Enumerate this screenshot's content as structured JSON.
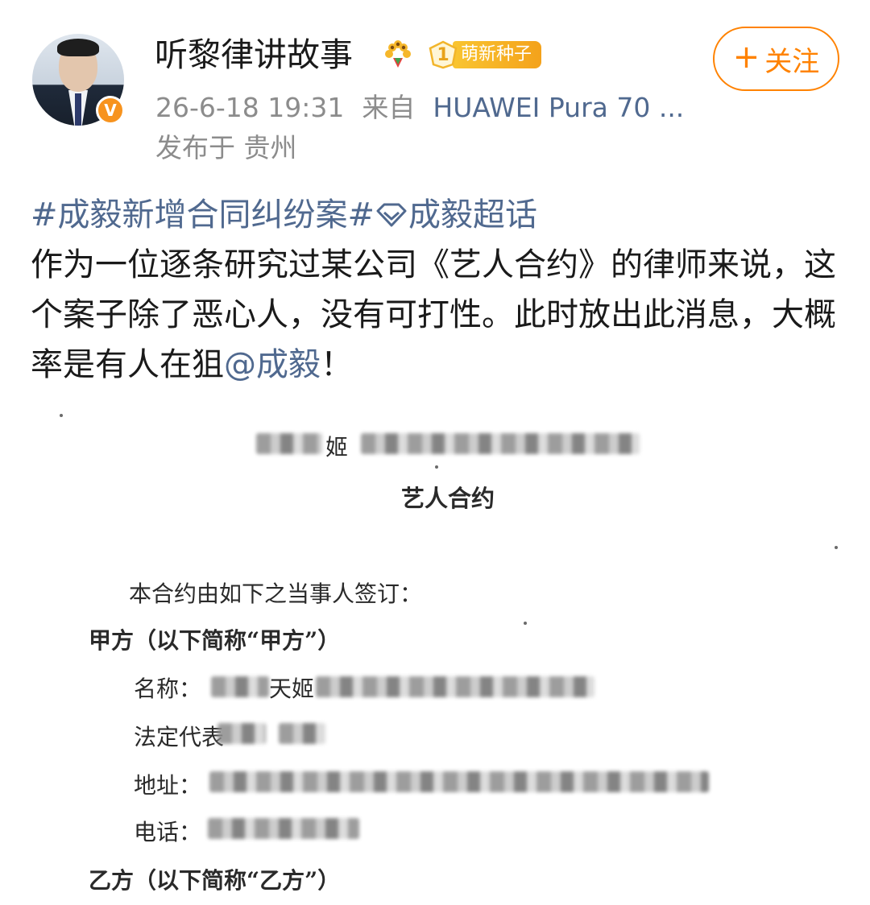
{
  "post": {
    "author": {
      "name": "听黎律讲故事",
      "verified_badge": "V",
      "level_number": "1",
      "level_label": "萌新种子",
      "decoration_icon": "sunflower-icon"
    },
    "follow_label": "关注",
    "follow_plus": "+",
    "timestamp": "26-6-18 19:31",
    "source_prefix": "来自",
    "device": "HUAWEI Pura 70 ...",
    "location": "发布于 贵州",
    "text": {
      "hashtag_topic": "#成毅新增合同纠纷案#",
      "supertopic": "成毅超话",
      "body_1": "作为一位逐条研究过某公司《艺人合约》的律师来说，这个案子除了恶心人，没有可打性。此时放出此消息，大概率是有人在狙",
      "mention": "@成毅",
      "body_2": "！"
    },
    "colors": {
      "link": "#50698f",
      "follow": "#ff8200",
      "meta": "#8c8c8c",
      "verified": "#f7931e"
    }
  },
  "document": {
    "header_char": "姬",
    "title": "艺人合约",
    "intro": "本合约由如下之当事人签订：",
    "party_a": "甲方（以下简称“甲方”）",
    "name_label": "名称：",
    "name_partial": "天姬",
    "rep_label": "法定代表",
    "address_label": "地址：",
    "phone_label": "电话：",
    "party_b": "乙方（以下简称“乙方”）"
  }
}
